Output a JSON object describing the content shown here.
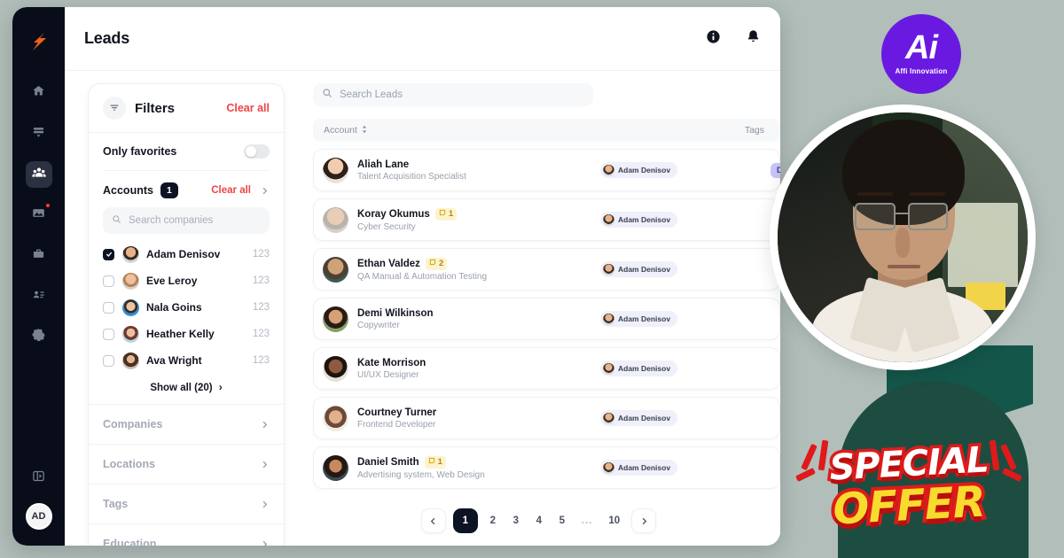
{
  "background_color": "#b1beb9",
  "sidebar": {
    "logo_icon": "brand-bird-logo-icon",
    "items": [
      {
        "icon": "home-icon",
        "name": "home",
        "active": false,
        "badge": false
      },
      {
        "icon": "board-icon",
        "name": "boards",
        "active": false,
        "badge": false
      },
      {
        "icon": "people-icon",
        "name": "leads",
        "active": true,
        "badge": false
      },
      {
        "icon": "mail-image-icon",
        "name": "campaigns",
        "active": false,
        "badge": true
      },
      {
        "icon": "briefcase-icon",
        "name": "jobs",
        "active": false,
        "badge": false
      },
      {
        "icon": "contact-card-icon",
        "name": "contacts",
        "active": false,
        "badge": false
      },
      {
        "icon": "gear-icon",
        "name": "settings",
        "active": false,
        "badge": false
      }
    ],
    "collapse_icon": "panel-collapse-icon",
    "avatar_initials": "AD"
  },
  "header": {
    "title": "Leads",
    "help_icon": "help-info-icon",
    "notifications_icon": "bell-icon"
  },
  "filters": {
    "filter_icon": "filter-funnel-icon",
    "title": "Filters",
    "clear_all_label": "Clear all",
    "only_favorites_label": "Only favorites",
    "only_favorites_on": false,
    "accounts_label": "Accounts",
    "accounts_count": "1",
    "accounts_clear_all_label": "Clear all",
    "search_companies_placeholder": "Search companies",
    "search_companies_value": "",
    "accounts": [
      {
        "name": "Adam Denisov",
        "count": "123",
        "checked": true
      },
      {
        "name": "Eve Leroy",
        "count": "123",
        "checked": false
      },
      {
        "name": "Nala Goins",
        "count": "123",
        "checked": false
      },
      {
        "name": "Heather Kelly",
        "count": "123",
        "checked": false
      },
      {
        "name": "Ava Wright",
        "count": "123",
        "checked": false
      }
    ],
    "show_all_label": "Show all (20)",
    "groups": [
      {
        "label": "Companies"
      },
      {
        "label": "Locations"
      },
      {
        "label": "Tags"
      },
      {
        "label": "Education"
      }
    ]
  },
  "leads": {
    "search_placeholder": "Search Leads",
    "search_value": "",
    "columns": {
      "account": "Account",
      "tags": "Tags"
    },
    "sort_icon": "sort-updown-icon",
    "rows": [
      {
        "name": "Aliah Lane",
        "role": "Talent Acquisition Specialist",
        "notes": "",
        "assignee": "Adam Denisov",
        "tag": "De"
      },
      {
        "name": "Koray Okumus",
        "role": "Cyber Security",
        "notes": "1",
        "assignee": "Adam Denisov",
        "tag": ""
      },
      {
        "name": "Ethan Valdez",
        "role": "QA Manual & Automation Testing",
        "notes": "2",
        "assignee": "Adam Denisov",
        "tag": ""
      },
      {
        "name": "Demi Wilkinson",
        "role": "Copywriter",
        "notes": "",
        "assignee": "Adam Denisov",
        "tag": ""
      },
      {
        "name": "Kate Morrison",
        "role": "UI/UX Designer",
        "notes": "",
        "assignee": "Adam Denisov",
        "tag": ""
      },
      {
        "name": "Courtney Turner",
        "role": "Frontend Developer",
        "notes": "",
        "assignee": "Adam Denisov",
        "tag": ""
      },
      {
        "name": "Daniel Smith",
        "role": "Advertising system, Web Design",
        "notes": "1",
        "assignee": "Adam Denisov",
        "tag": ""
      }
    ],
    "pagination": {
      "prev_icon": "chevron-left-icon",
      "next_icon": "chevron-right-icon",
      "pages": [
        "1",
        "2",
        "3",
        "4",
        "5",
        "...",
        "10"
      ],
      "current": "1"
    }
  },
  "overlay": {
    "brand": {
      "mark": "Ai",
      "name": "Affi Innovation",
      "color": "#6a1ae0"
    },
    "portrait_alt": "presenter-photo",
    "offer": {
      "line1": "SPECIAL",
      "line2": "OFFER",
      "red": "#e01a1a",
      "yellow": "#f7dc2e"
    }
  }
}
